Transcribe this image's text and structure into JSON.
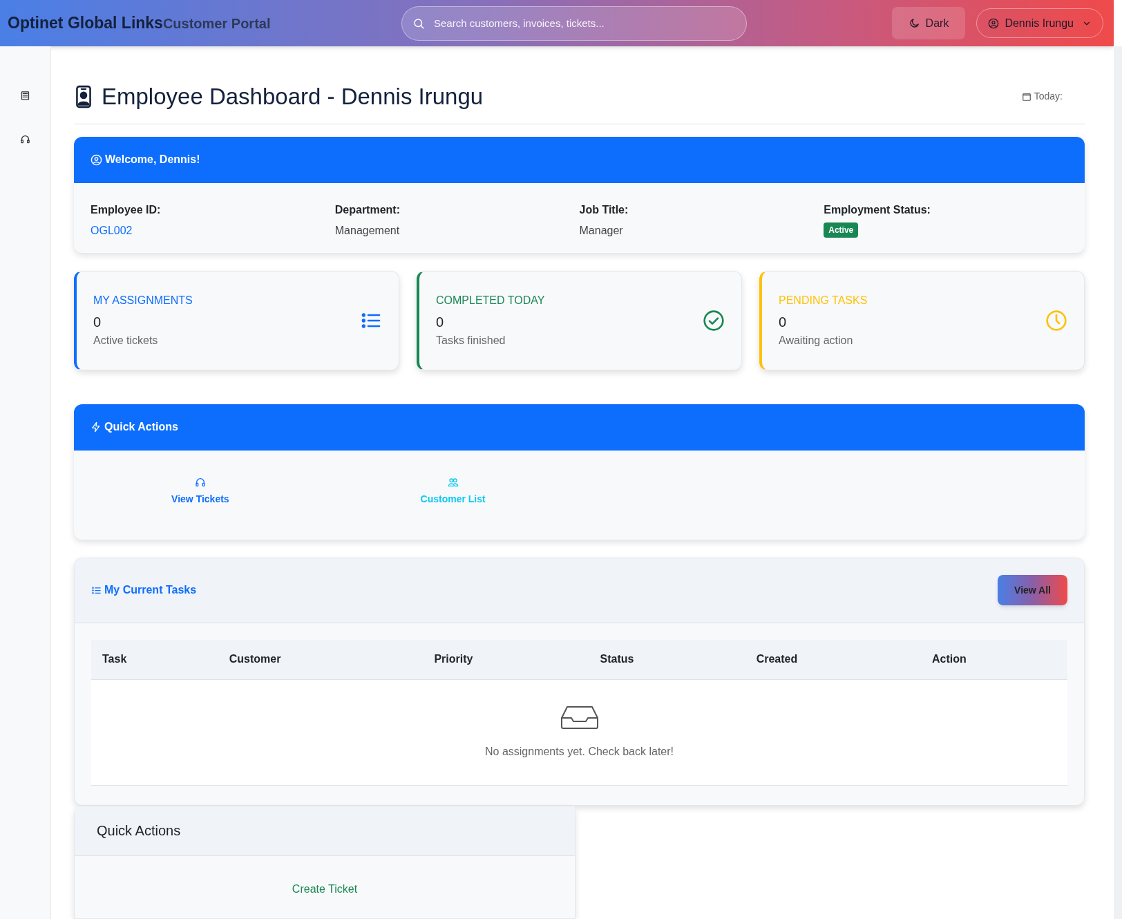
{
  "header": {
    "brand": "Optinet Global Links",
    "subtitle": "Customer Portal",
    "search": {
      "placeholder": "Search customers, invoices, tickets..."
    },
    "theme_button": "Dark",
    "user_menu": "Dennis Irungu"
  },
  "sidebar": {
    "items": [
      {
        "kind": "list"
      },
      {
        "kind": "headset"
      }
    ]
  },
  "page": {
    "title": "Employee Dashboard - Dennis Irungu",
    "date_label": "Today:"
  },
  "welcome": {
    "title": "Welcome, Dennis!",
    "fields": [
      {
        "label": "Employee ID:",
        "value": "OGL002",
        "kind": "link"
      },
      {
        "label": "Department:",
        "value": "Management",
        "kind": "text"
      },
      {
        "label": "Job Title:",
        "value": "Manager",
        "kind": "text"
      },
      {
        "label": "Employment Status:",
        "value": "Active",
        "kind": "badge"
      }
    ]
  },
  "stats": [
    {
      "title": "MY ASSIGNMENTS",
      "value": "0",
      "caption": "Active tickets",
      "color": "#0d6efd",
      "kind": "list"
    },
    {
      "title": "COMPLETED TODAY",
      "value": "0",
      "caption": "Tasks finished",
      "color": "#198754",
      "kind": "check"
    },
    {
      "title": "PENDING TASKS",
      "value": "0",
      "caption": "Awaiting action",
      "color": "#ffc107",
      "kind": "clock"
    }
  ],
  "quick_actions": {
    "title": "Quick Actions",
    "items": [
      {
        "label": "View Tickets",
        "kind": "headset",
        "color": "#0d6efd"
      },
      {
        "label": "Customer List",
        "kind": "users",
        "color": "#0dcaf0"
      }
    ]
  },
  "tasks": {
    "title": "My Current Tasks",
    "view_all": "View All",
    "columns": [
      "Task",
      "Customer",
      "Priority",
      "Status",
      "Created",
      "Action"
    ],
    "empty_message": "No assignments yet. Check back later!"
  },
  "quick_actions_2": {
    "title": "Quick Actions",
    "items": [
      {
        "label": "Create Ticket"
      }
    ]
  }
}
